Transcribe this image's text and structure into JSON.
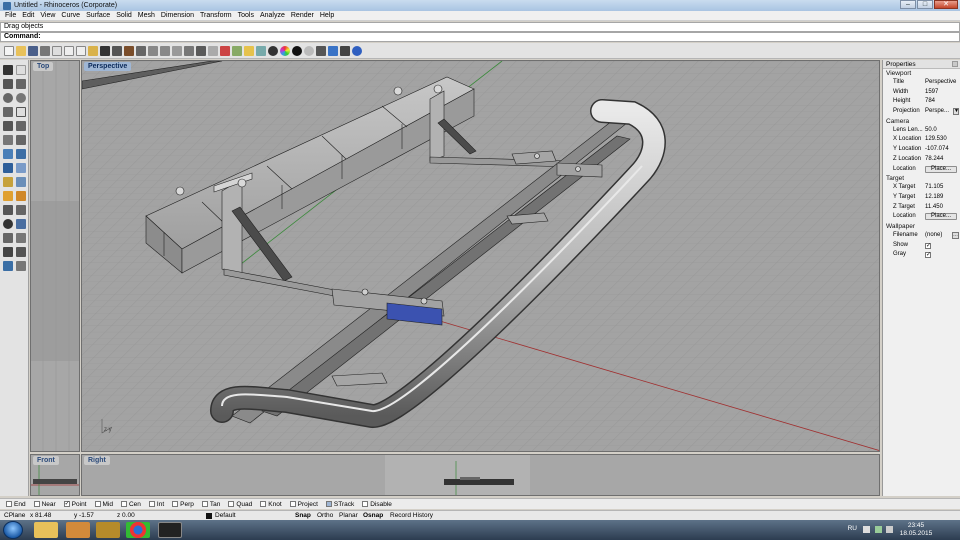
{
  "window": {
    "title": "Untitled - Rhinoceros (Corporate)",
    "controls": [
      "–",
      "□",
      "✕"
    ]
  },
  "menu": [
    "File",
    "Edit",
    "View",
    "Curve",
    "Surface",
    "Solid",
    "Mesh",
    "Dimension",
    "Transform",
    "Tools",
    "Analyze",
    "Render",
    "Help"
  ],
  "command": {
    "history": "Drag objects",
    "prompt": "Command:",
    "value": ""
  },
  "viewports": {
    "top": "Top",
    "perspective": "Perspective",
    "front": "Front",
    "right": "Right",
    "axis_label": "z  y"
  },
  "properties": {
    "title": "Properties",
    "sections": {
      "viewport": "Viewport",
      "camera": "Camera",
      "target": "Target",
      "wallpaper": "Wallpaper"
    },
    "viewport": {
      "title_label": "Title",
      "title_value": "Perspective",
      "width_label": "Width",
      "width_value": "1597",
      "height_label": "Height",
      "height_value": "784",
      "projection_label": "Projection",
      "projection_value": "Perspe..."
    },
    "camera": {
      "lens_label": "Lens Len...",
      "lens_value": "50.0",
      "xloc_label": "X Location",
      "xloc_value": "129.530",
      "yloc_label": "Y Location",
      "yloc_value": "-107.074",
      "zloc_label": "Z Location",
      "zloc_value": "78.244",
      "location_label": "Location",
      "place_button": "Place..."
    },
    "target": {
      "xt_label": "X Target",
      "xt_value": "71.105",
      "yt_label": "Y Target",
      "yt_value": "12.189",
      "zt_label": "Z Target",
      "zt_value": "11.450",
      "location_label": "Location",
      "place_button": "Place..."
    },
    "wallpaper": {
      "filename_label": "Filename",
      "filename_value": "(none)",
      "show_label": "Show",
      "show_checked": true,
      "gray_label": "Gray",
      "gray_checked": true
    }
  },
  "osnaps": [
    {
      "label": "End",
      "checked": false
    },
    {
      "label": "Near",
      "checked": false
    },
    {
      "label": "Point",
      "checked": true
    },
    {
      "label": "Mid",
      "checked": false
    },
    {
      "label": "Cen",
      "checked": false
    },
    {
      "label": "Int",
      "checked": false
    },
    {
      "label": "Perp",
      "checked": false
    },
    {
      "label": "Tan",
      "checked": false
    },
    {
      "label": "Quad",
      "checked": false
    },
    {
      "label": "Knot",
      "checked": false
    },
    {
      "label": "Project",
      "checked": false
    },
    {
      "label": "STrack",
      "checked": false
    },
    {
      "label": "Disable",
      "checked": false
    }
  ],
  "status": {
    "cplane": "CPlane",
    "x": "x 81.48",
    "y": "y -1.57",
    "z": "z 0.00",
    "layer": "Default",
    "snap": "Snap",
    "ortho": "Ortho",
    "planar": "Planar",
    "osnap": "Osnap",
    "record": "Record History"
  },
  "taskbar": {
    "lang": "RU",
    "time": "23:45",
    "date": "18.05.2015"
  },
  "colors": {
    "viewport_bg": "#a3a3a3",
    "grid_line": "#8f8f8f",
    "x_axis": "#9b2b2b",
    "y_axis": "#2e8b2e",
    "active_label": "#9fb6d4"
  }
}
